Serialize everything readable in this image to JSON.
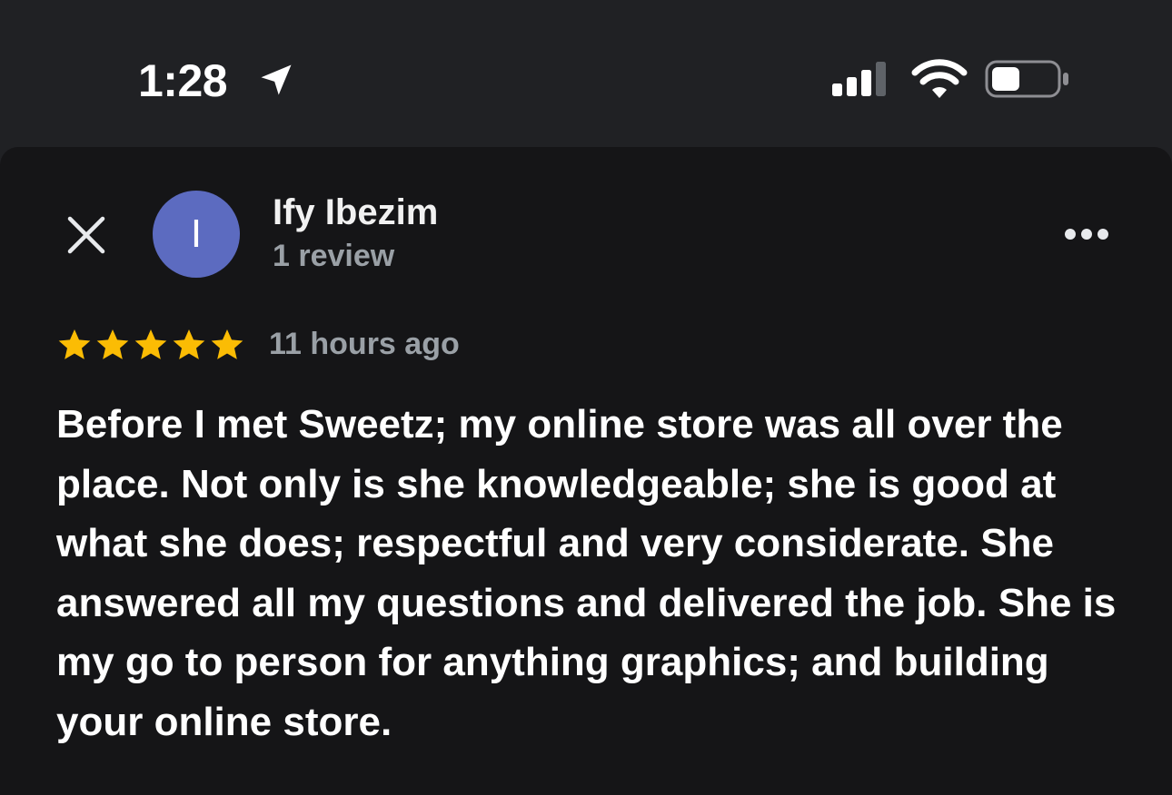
{
  "status_bar": {
    "time": "1:28",
    "icons": [
      "location-arrow-icon",
      "cellular-signal-icon",
      "wifi-icon",
      "battery-icon"
    ]
  },
  "review": {
    "avatar_initial": "I",
    "avatar_color": "#5c6bc0",
    "reviewer_name": "Ify Ibezim",
    "review_count": "1 review",
    "rating": 5,
    "star_color": "#fbbc04",
    "time_ago": "11 hours ago",
    "text": "Before I met Sweetz; my online store was all over the place. Not only is she knowledgeable; she is good at what she does; respectful and very considerate. She answered all my questions and delivered the job. She is my go to person for anything graphics; and building your online store."
  },
  "colors": {
    "background": "#202124",
    "sheet": "#151517",
    "secondary_text": "#9aa0a6"
  }
}
